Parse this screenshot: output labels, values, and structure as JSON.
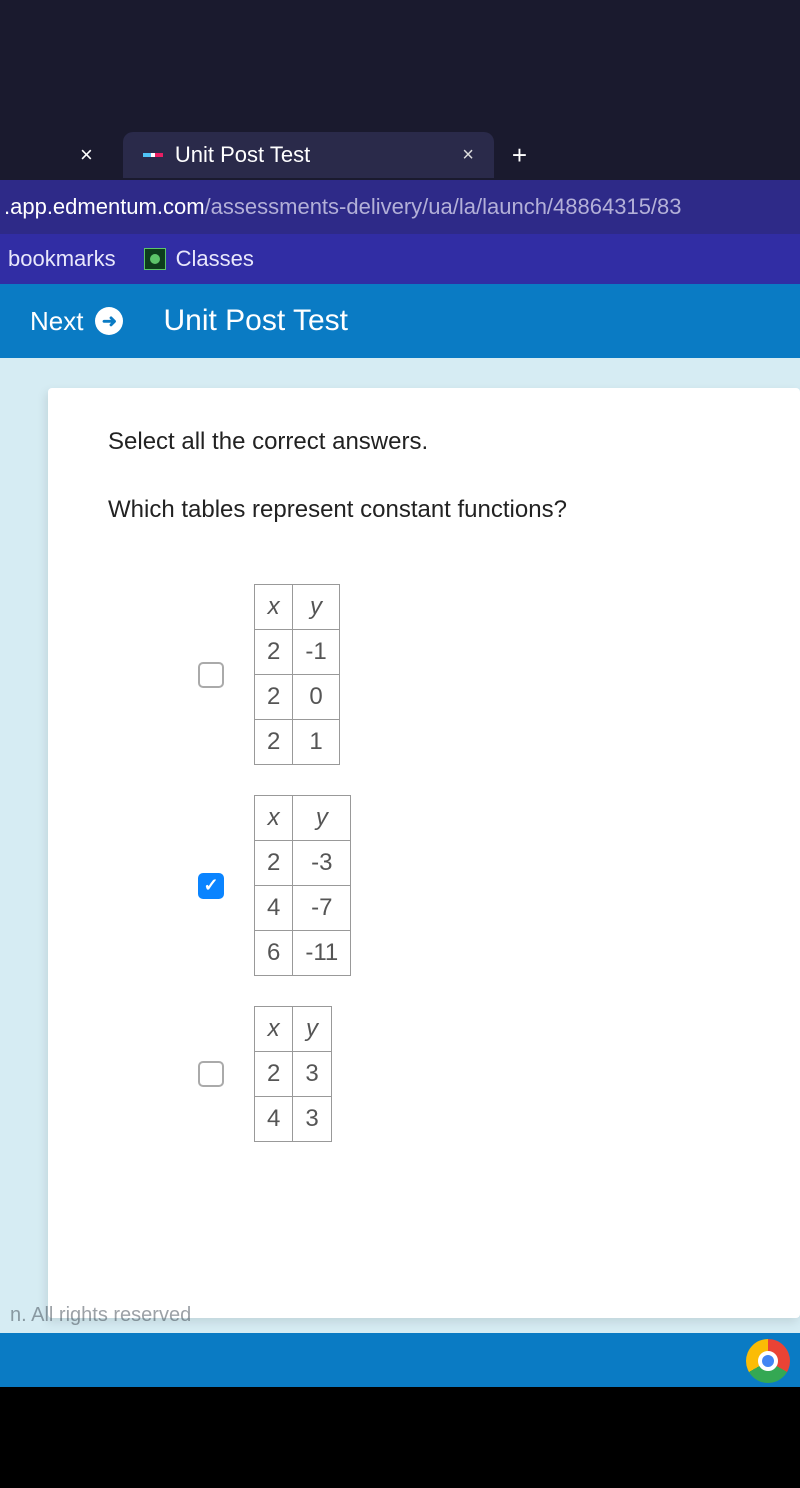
{
  "browser": {
    "tab_title": "Unit Post Test",
    "url_domain": ".app.edmentum.com",
    "url_path": "/assessments-delivery/ua/la/launch/48864315/83",
    "bookmarks_label": "bookmarks",
    "classes_label": "Classes"
  },
  "app": {
    "next_label": "Next",
    "page_title": "Unit Post Test"
  },
  "question": {
    "instruction": "Select all the correct answers.",
    "text": "Which tables represent constant functions?"
  },
  "tables": [
    {
      "checked": false,
      "headers": [
        "x",
        "y"
      ],
      "rows": [
        [
          "2",
          "-1"
        ],
        [
          "2",
          "0"
        ],
        [
          "2",
          "1"
        ]
      ]
    },
    {
      "checked": true,
      "headers": [
        "x",
        "y"
      ],
      "rows": [
        [
          "2",
          "-3"
        ],
        [
          "4",
          "-7"
        ],
        [
          "6",
          "-11"
        ]
      ]
    },
    {
      "checked": false,
      "headers": [
        "x",
        "y"
      ],
      "rows": [
        [
          "2",
          "3"
        ],
        [
          "4",
          "3"
        ]
      ]
    }
  ],
  "footer": "n. All rights reserved",
  "chart_data": {
    "type": "table",
    "title": "Function tables options",
    "tables": [
      {
        "x": [
          2,
          2,
          2
        ],
        "y": [
          -1,
          0,
          1
        ]
      },
      {
        "x": [
          2,
          4,
          6
        ],
        "y": [
          -3,
          -7,
          -11
        ]
      },
      {
        "x": [
          2,
          4
        ],
        "y": [
          3,
          3
        ]
      }
    ]
  }
}
